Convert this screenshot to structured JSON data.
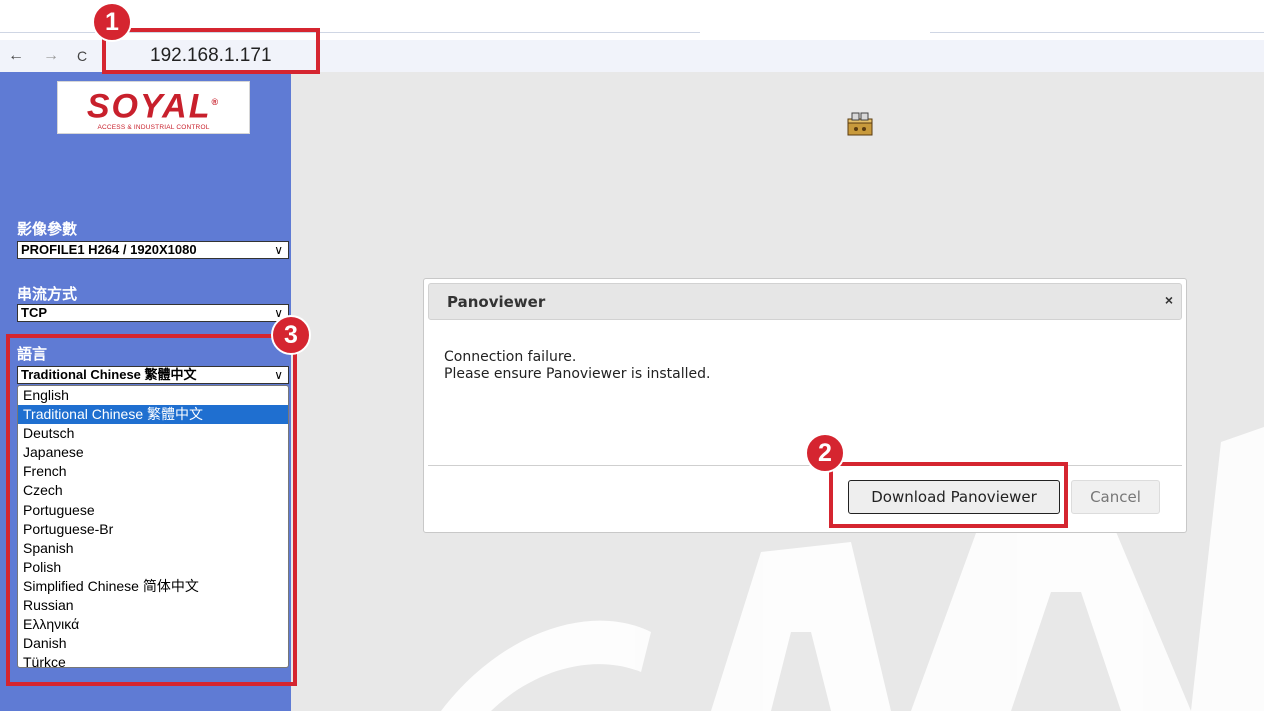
{
  "browser": {
    "url": "192.168.1.171",
    "back_icon": "←",
    "forward_icon": "→",
    "reload_icon": "C"
  },
  "sidebar": {
    "logo": {
      "main": "SOYAL",
      "registered": "®",
      "tagline": "ACCESS & INDUSTRIAL CONTROL"
    },
    "video_params": {
      "label": "影像參數",
      "value": "PROFILE1 H264 / 1920X1080"
    },
    "streaming": {
      "label": "串流方式",
      "value": "TCP"
    },
    "language": {
      "label": "語言",
      "value": "Traditional Chinese 繁體中文",
      "options": [
        "English",
        "Traditional Chinese 繁體中文",
        "Deutsch",
        "Japanese",
        "French",
        "Czech",
        "Portuguese",
        "Portuguese-Br",
        "Spanish",
        "Polish",
        "Simplified Chinese 简体中文",
        "Russian",
        "Ελληνικά",
        "Danish",
        "Türkçe"
      ],
      "selected_index": 1
    },
    "chevron": "∨"
  },
  "dialog": {
    "title": "Panoviewer",
    "close": "×",
    "message_line1": "Connection failure.",
    "message_line2": "Please ensure Panoviewer is installed.",
    "download_label": "Download Panoviewer",
    "cancel_label": "Cancel"
  },
  "annotations": {
    "step1": "1",
    "step2": "2",
    "step3": "3"
  },
  "colors": {
    "sidebar_bg": "#5f7bd4",
    "annotation_red": "#d52530",
    "selected_blue": "#1f6fd0",
    "brand_red": "#c8202c"
  }
}
